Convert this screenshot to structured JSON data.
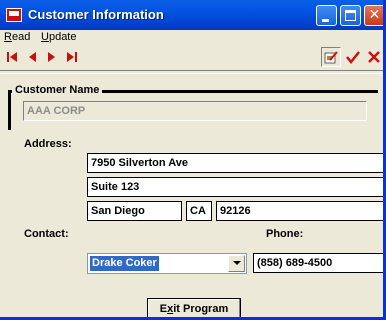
{
  "window": {
    "title": "Customer Information"
  },
  "menu": {
    "read": {
      "accel": "R",
      "rest": "ead"
    },
    "update": {
      "accel": "U",
      "rest": "pdate"
    }
  },
  "toolbar": {
    "nav_icons": [
      "first-record-icon",
      "previous-record-icon",
      "next-record-icon",
      "last-record-icon"
    ],
    "action_icons": [
      "edit-icon",
      "save-check-icon",
      "cancel-x-icon"
    ]
  },
  "customer": {
    "group_label": "Customer Name",
    "name": "AAA CORP"
  },
  "address": {
    "label": "Address:",
    "line1": "7950 Silverton Ave",
    "line2": "Suite 123",
    "city": "San Diego",
    "state": "CA",
    "zip": "92126"
  },
  "contact": {
    "label": "Contact:",
    "selected": "Drake Coker"
  },
  "phone": {
    "label": "Phone:",
    "value": "(858) 689-4500"
  },
  "exit_button": {
    "accel_before": "E",
    "accel": "x",
    "rest": "it Program"
  },
  "colors": {
    "title_bar": "#0455e4",
    "window_bg": "#ece9d8",
    "nav_arrow": "#c81010",
    "check": "#d01010",
    "selection": "#316ac5"
  }
}
